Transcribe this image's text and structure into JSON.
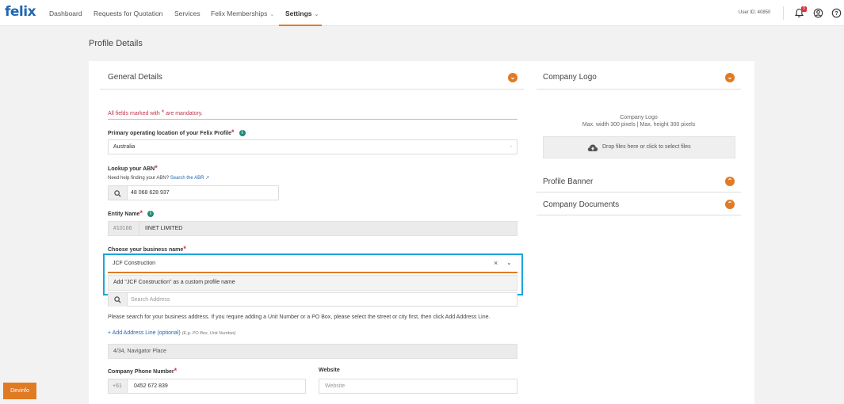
{
  "brand": {
    "logo": "felix"
  },
  "nav": {
    "items": [
      "Dashboard",
      "Requests for Quotation",
      "Services",
      "Felix Memberships",
      "Settings"
    ],
    "user_id": "User ID: 40850",
    "notification_count": "3"
  },
  "page": {
    "title": "Profile Details"
  },
  "general": {
    "heading": "General Details",
    "mandatory_prefix": "All fields marked with ",
    "mandatory_suffix": " are mandatory.",
    "location_label": "Primary operating location of your Felix Profile",
    "location_value": "Australia",
    "abn_label": "Lookup your ABN",
    "abn_help": "Need help finding your ABN?",
    "abn_help_link": "Search the ABR",
    "abn_value": "48 068 628 937",
    "entity_label": "Entity Name",
    "entity_code": "#10166",
    "entity_value": "IINET LIMITED",
    "business_label": "Choose your business name",
    "business_value": "JCF Construction",
    "business_option": "Add \"JCF Construction\" as a custom profile name",
    "address_placeholder": "Search Address",
    "address_note": "Please search for your business address. If you require adding a Unit Number or a PO Box, please select the street or city first, then click Add Address Line.",
    "add_address_line": "+ Add Address Line (optional)",
    "add_address_hint": "(E.g. PO Box, Unit Number)",
    "address_value": "4/34, Navigator Place",
    "phone_label": "Company Phone Number",
    "phone_prefix": "+61",
    "phone_value": "0452 672 839",
    "website_label": "Website",
    "website_placeholder": "Website"
  },
  "company_logo": {
    "heading": "Company Logo",
    "text_line1": "Company Logo",
    "text_line2": "Max. width 300 pixels | Max. height 300 pixels",
    "drop_text": "Drop files here or click to select files"
  },
  "profile_banner": {
    "heading": "Profile Banner"
  },
  "company_documents": {
    "heading": "Company Documents"
  },
  "devinfo": {
    "label": "Devinfo"
  },
  "colors": {
    "accent": "#e07b24",
    "brand": "#1f67b1",
    "highlight": "#1ba4dd",
    "required": "#d7303c"
  }
}
